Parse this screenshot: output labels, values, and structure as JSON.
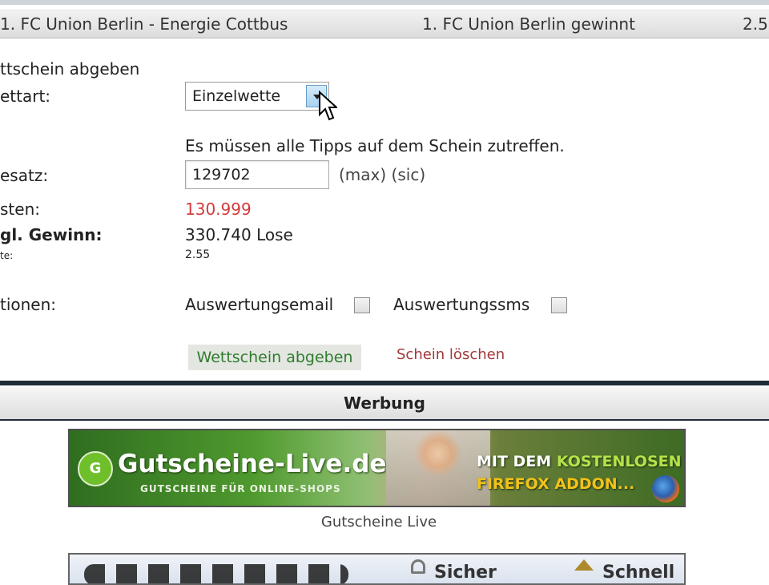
{
  "match": {
    "teams": "1. FC Union Berlin - Energie Cottbus",
    "tip": "1. FC Union Berlin gewinnt",
    "odds": "2.5"
  },
  "form": {
    "heading": "ttschein abgeben",
    "bet_type_label": "ettart:",
    "bet_type_value": "Einzelwette",
    "hint": "Es müssen alle Tipps auf dem Schein zutreffen.",
    "stake_label": "esatz:",
    "stake_value": "129702",
    "stake_note": "(max) (sic)",
    "cost_label": "sten:",
    "cost_value": "130.999",
    "win_label": "gl. Gewinn:",
    "win_value": "330.740 Lose",
    "quote_label": "te:",
    "quote_value": "2.55",
    "options_label": "tionen:",
    "option_email": "Auswertungsemail",
    "option_sms": "Auswertungssms",
    "submit_label": "Wettschein abgeben",
    "delete_label": "Schein löschen"
  },
  "ads": {
    "header": "Werbung",
    "banner": {
      "logo_text": "G",
      "title": "Gutscheine-Live.de",
      "subtitle": "GUTSCHEINE FÜR ONLINE-SHOPS",
      "cta_line1_prefix": "MIT DEM ",
      "cta_line1_highlight": "KOSTENLOSEN",
      "cta_line2": "FIREFOX ADDON...",
      "caption": "Gutscheine Live"
    },
    "banner2": {
      "item1": "Sicher",
      "item2": "Schnell"
    }
  },
  "colors": {
    "cost_red": "#d23b3b",
    "submit_green": "#2e7d2e",
    "delete_red": "#a13a3a",
    "dark_separator": "#1e2b38"
  },
  "icons": [
    "dropdown-arrow-icon",
    "mouse-cursor-icon",
    "firefox-icon",
    "lock-icon",
    "house-icon"
  ]
}
